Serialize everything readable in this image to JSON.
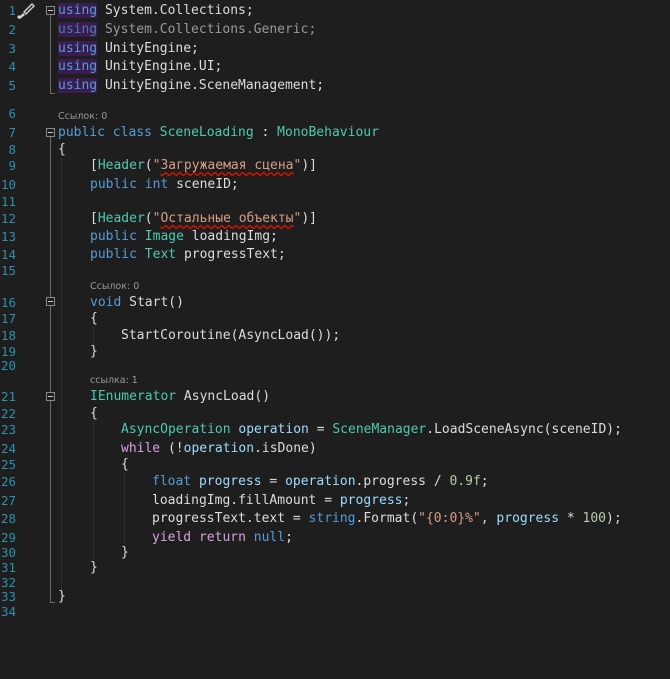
{
  "editor": {
    "icons": {
      "gutter": "brush-icon"
    },
    "line_numbers": [
      "1",
      "2",
      "3",
      "4",
      "5",
      "6",
      "7",
      "8",
      "9",
      "10",
      "11",
      "12",
      "13",
      "14",
      "15",
      "16",
      "17",
      "18",
      "19",
      "20",
      "21",
      "22",
      "23",
      "24",
      "25",
      "26",
      "27",
      "28",
      "29",
      "30",
      "31",
      "32",
      "33",
      "34"
    ],
    "lens": {
      "class_refs": "Ссылок: 0",
      "start_refs": "Ссылок: 0",
      "asyncload_refs": "ссылка: 1"
    },
    "tokens": {
      "using": "using",
      "sys_collections": "System.Collections;",
      "sys_collections_generic": "System.Collections.Generic;",
      "unity_engine": "UnityEngine;",
      "unity_engine_ui": "UnityEngine.UI;",
      "unity_scene_mgmt": "UnityEngine.SceneManagement;",
      "public": "public",
      "class": "class",
      "class_name": "SceneLoading",
      "colon": ":",
      "mono_behaviour": "MonoBehaviour",
      "brace_open": "{",
      "brace_close": "}",
      "bracket_open": "[",
      "bracket_close": "]",
      "header_attr": "Header",
      "paren_open": "(",
      "paren_close": ")",
      "quote": "\"",
      "header1_text": "Загружаемая сцена",
      "header2_text": "Остальные объекты",
      "int": "int",
      "scene_id_decl": "sceneID;",
      "image_type": "Image",
      "loading_img_decl": "loadingImg;",
      "text_type": "Text",
      "progress_text_decl": "progressText;",
      "void": "void",
      "start_fn": "Start",
      "empty_parens": "()",
      "start_coroutine": "StartCoroutine",
      "async_load": "AsyncLoad",
      "call_close": "());",
      "ienumerator": "IEnumerator",
      "async_operation": "AsyncOperation",
      "operation": "operation",
      "equals": "=",
      "scene_manager": "SceneManager",
      "dot": ".",
      "load_scene_async": "LoadSceneAsync",
      "scene_id_arg": "(sceneID);",
      "while": "while",
      "not_open": "(!",
      "is_done": ".isDone)",
      "float": "float",
      "progress": "progress",
      "dot_progress": ".progress",
      "divide": "/",
      "num_09f": "0.9f",
      "semicolon": ";",
      "loading_img": "loadingImg",
      "fill_amount": ".fillAmount",
      "progress_text": "progressText",
      "dot_text": ".text",
      "string_kw": "string",
      "format": "Format",
      "format_str": "\"{0:0}%\"",
      "comma": ",",
      "multiply": "*",
      "num_100": "100",
      "close_paren_semi": ");",
      "yield": "yield",
      "return": "return",
      "null": "null"
    }
  }
}
